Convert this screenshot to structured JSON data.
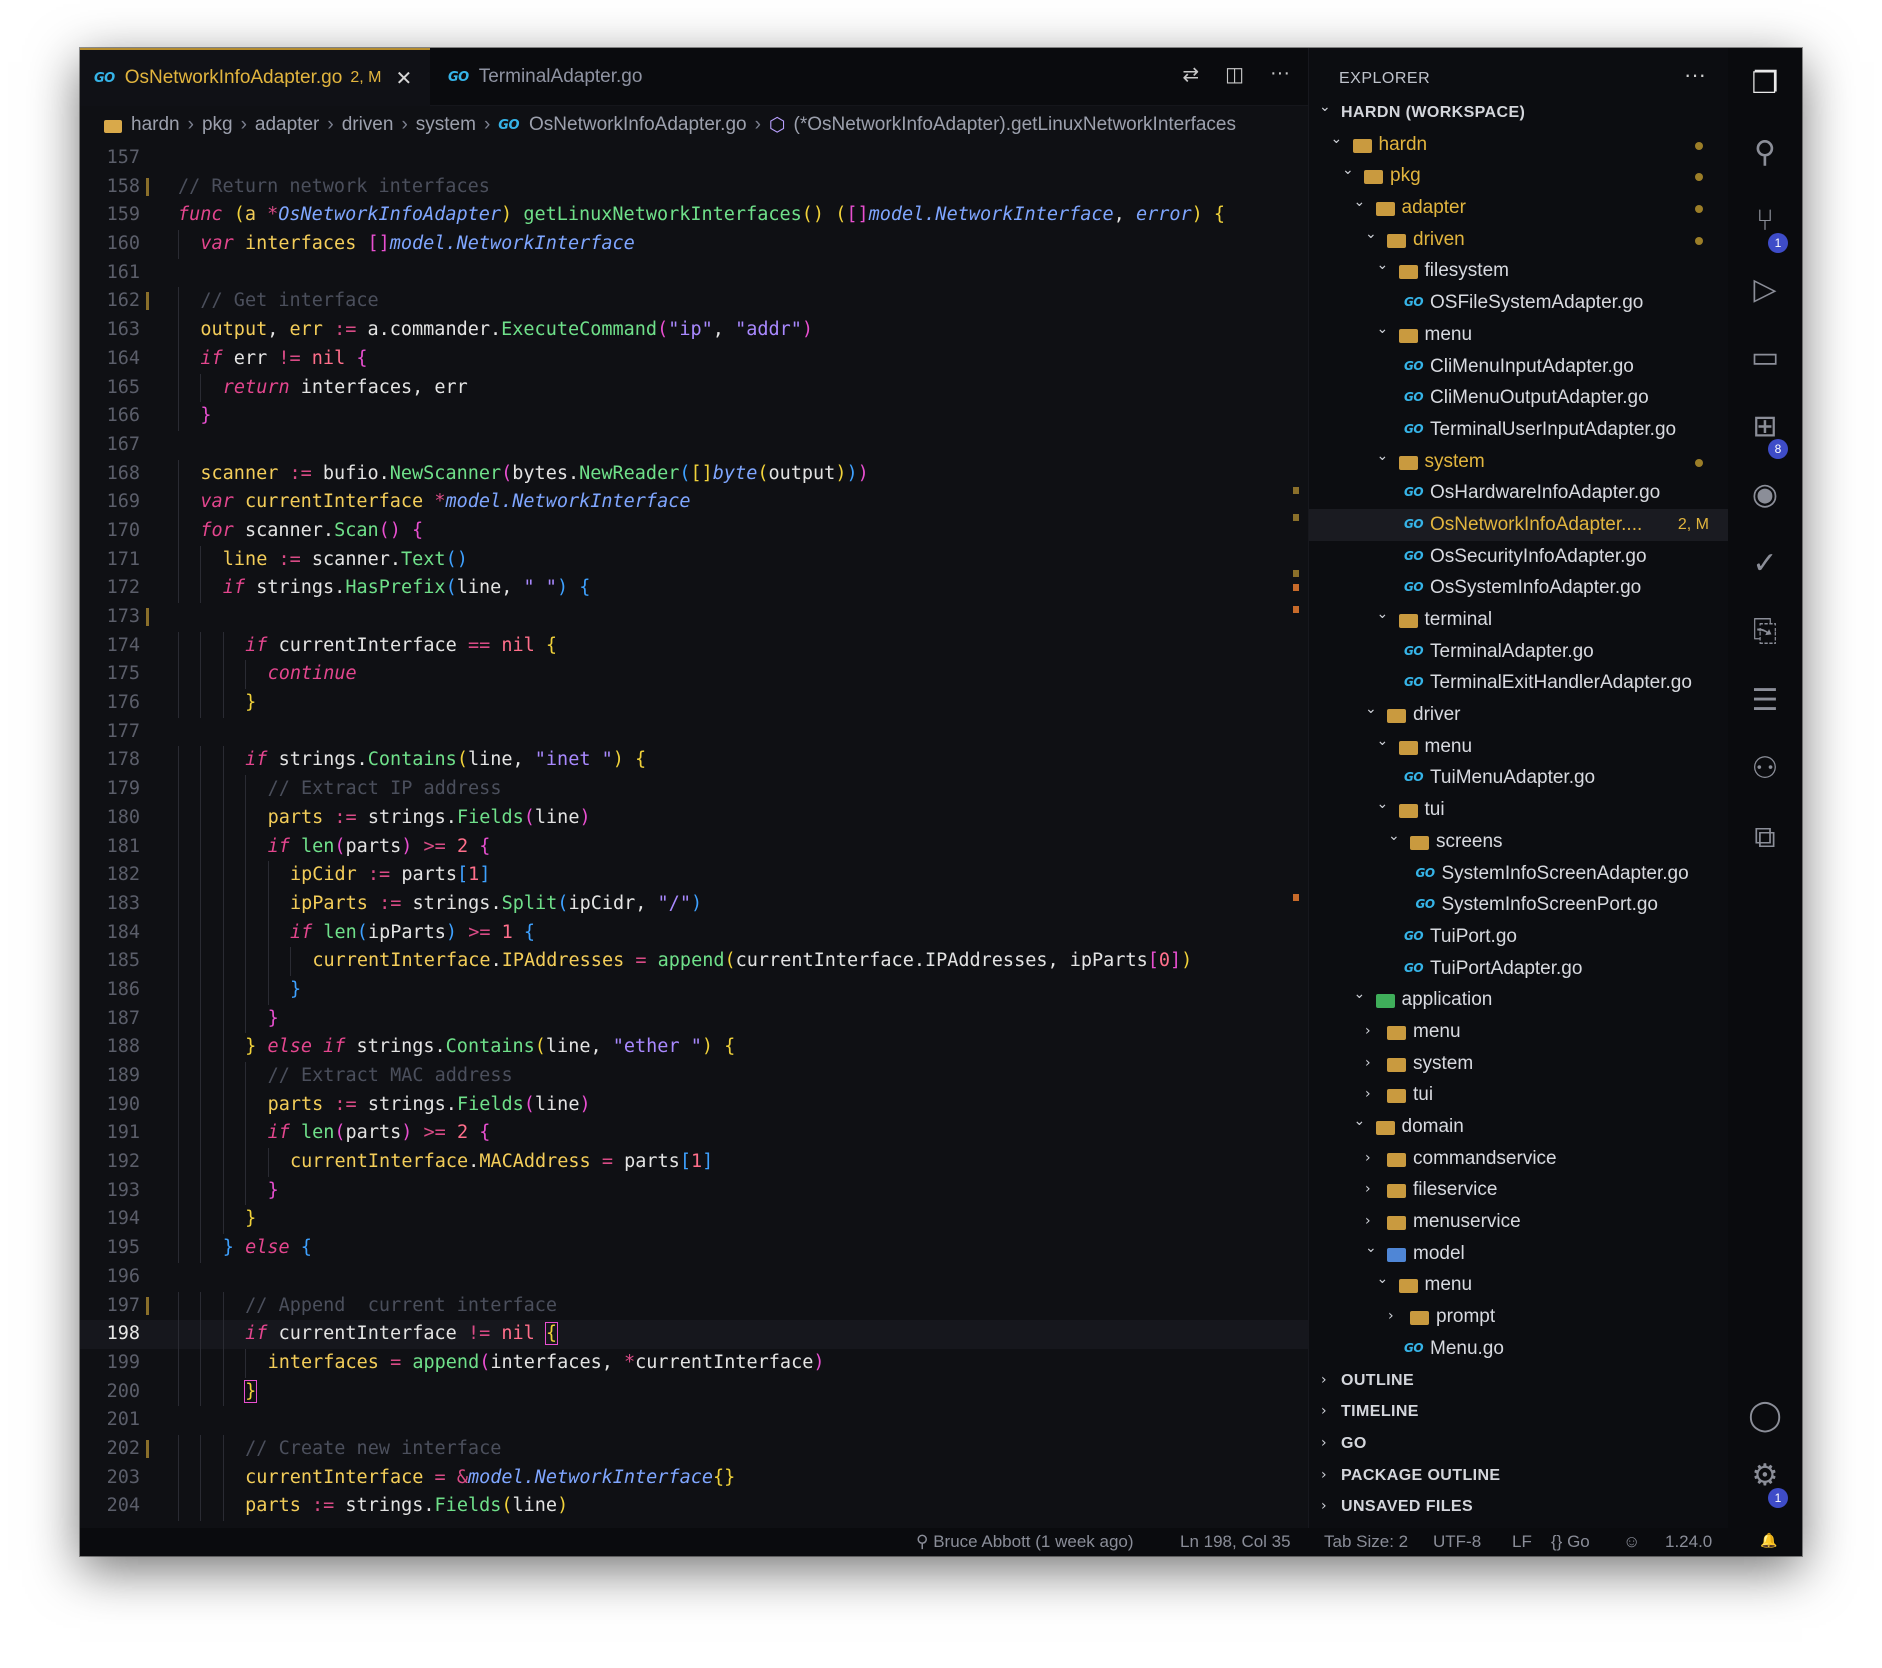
{
  "tabs": [
    {
      "label": "OsNetworkInfoAdapter.go",
      "status": "2, M",
      "close": "✕",
      "lang": "GO"
    },
    {
      "label": "TerminalAdapter.go",
      "lang": "GO"
    }
  ],
  "tab_actions": [
    "git-compare-icon",
    "split-editor-icon",
    "more-actions-icon"
  ],
  "breadcrumbs": [
    "hardn",
    "pkg",
    "adapter",
    "driven",
    "system",
    "OsNetworkInfoAdapter.go",
    "(*OsNetworkInfoAdapter).getLinuxNetworkInterfaces"
  ],
  "editor": {
    "current_line": "198",
    "lines": [
      {
        "n": "157",
        "html": ""
      },
      {
        "n": "158",
        "html": "<span class=\"cm\">// Return network interfaces</span>"
      },
      {
        "n": "159",
        "html": "<span class=\"kw\">func</span> <span class=\"b1\">(</span><span class=\"va\">a</span> <span class=\"op\">*</span><span class=\"ty\">OsNetworkInfoAdapter</span><span class=\"b1\">)</span> <span class=\"fn\">getLinuxNetworkInterfaces</span><span class=\"b1\">()</span> <span class=\"b1\">(</span><span class=\"b2\">[]</span><span class=\"ty\">model.NetworkInterface</span>, <span class=\"ty\">error</span><span class=\"b1\">)</span> <span class=\"b1\">{</span>"
      },
      {
        "n": "160",
        "html": "<span class=\"ig\"></span><span class=\"kw\">var</span> <span class=\"va\">interfaces</span> <span class=\"b2\">[]</span><span class=\"ty\">model.NetworkInterface</span>"
      },
      {
        "n": "161",
        "html": ""
      },
      {
        "n": "162",
        "html": "<span class=\"ig\"></span><span class=\"cm\">// Get interface</span>"
      },
      {
        "n": "163",
        "html": "<span class=\"ig\"></span><span class=\"va\">output</span>, <span class=\"va\">err</span> <span class=\"op\">:=</span> a.commander.<span class=\"fn\">ExecuteCommand</span><span class=\"b2\">(</span><span class=\"st\">\"ip\"</span>, <span class=\"st\">\"addr\"</span><span class=\"b2\">)</span>"
      },
      {
        "n": "164",
        "html": "<span class=\"ig\"></span><span class=\"kw\">if</span> err <span class=\"op\">!=</span> <span class=\"nu\">nil</span> <span class=\"b2\">{</span>"
      },
      {
        "n": "165",
        "html": "<span class=\"ig\"></span><span class=\"ig\"></span><span class=\"kw\">return</span> interfaces, err"
      },
      {
        "n": "166",
        "html": "<span class=\"ig\"></span><span class=\"b2\">}</span>"
      },
      {
        "n": "167",
        "html": ""
      },
      {
        "n": "168",
        "html": "<span class=\"ig\"></span><span class=\"va\">scanner</span> <span class=\"op\">:=</span> bufio.<span class=\"fn\">NewScanner</span><span class=\"b2\">(</span>bytes.<span class=\"fn\">NewReader</span><span class=\"b3\">(</span><span class=\"b1\">[]</span><span class=\"ty\">byte</span><span class=\"b1\">(</span>output<span class=\"b1\">)</span><span class=\"b3\">)</span><span class=\"b2\">)</span>"
      },
      {
        "n": "169",
        "html": "<span class=\"ig\"></span><span class=\"kw\">var</span> <span class=\"va\">currentInterface</span> <span class=\"op\">*</span><span class=\"ty\">model.NetworkInterface</span>"
      },
      {
        "n": "170",
        "html": "<span class=\"ig\"></span><span class=\"kw\">for</span> scanner.<span class=\"fn\">Scan</span><span class=\"b2\">()</span> <span class=\"b2\">{</span>"
      },
      {
        "n": "171",
        "html": "<span class=\"ig\"></span><span class=\"ig\"></span><span class=\"va\">line</span> <span class=\"op\">:=</span> scanner.<span class=\"fn\">Text</span><span class=\"b3\">()</span>"
      },
      {
        "n": "172",
        "html": "<span class=\"ig\"></span><span class=\"ig\"></span><span class=\"kw\">if</span> strings.<span class=\"fn\">HasPrefix</span><span class=\"b3\">(</span>line, <span class=\"st\">\" \"</span><span class=\"b3\">)</span> <span class=\"b3\">{</span>"
      },
      {
        "n": "173",
        "html": ""
      },
      {
        "n": "174",
        "html": "<span class=\"ig\"></span><span class=\"ig\"></span><span class=\"ig\"></span><span class=\"kw\">if</span> currentInterface <span class=\"op\">==</span> <span class=\"nu\">nil</span> <span class=\"b1\">{</span>"
      },
      {
        "n": "175",
        "html": "<span class=\"ig\"></span><span class=\"ig\"></span><span class=\"ig\"></span><span class=\"ig\"></span><span class=\"kw\">continue</span>"
      },
      {
        "n": "176",
        "html": "<span class=\"ig\"></span><span class=\"ig\"></span><span class=\"ig\"></span><span class=\"b1\">}</span>"
      },
      {
        "n": "177",
        "html": ""
      },
      {
        "n": "178",
        "html": "<span class=\"ig\"></span><span class=\"ig\"></span><span class=\"ig\"></span><span class=\"kw\">if</span> strings.<span class=\"fn\">Contains</span><span class=\"b1\">(</span>line, <span class=\"st\">\"inet \"</span><span class=\"b1\">)</span> <span class=\"b1\">{</span>"
      },
      {
        "n": "179",
        "html": "<span class=\"ig\"></span><span class=\"ig\"></span><span class=\"ig\"></span><span class=\"ig\"></span><span class=\"cm\">// Extract IP address</span>"
      },
      {
        "n": "180",
        "html": "<span class=\"ig\"></span><span class=\"ig\"></span><span class=\"ig\"></span><span class=\"ig\"></span><span class=\"va\">parts</span> <span class=\"op\">:=</span> strings.<span class=\"fn\">Fields</span><span class=\"b2\">(</span>line<span class=\"b2\">)</span>"
      },
      {
        "n": "181",
        "html": "<span class=\"ig\"></span><span class=\"ig\"></span><span class=\"ig\"></span><span class=\"ig\"></span><span class=\"kw\">if</span> <span class=\"fn\">len</span><span class=\"b2\">(</span>parts<span class=\"b2\">)</span> <span class=\"op\">>=</span> <span class=\"nu\">2</span> <span class=\"b2\">{</span>"
      },
      {
        "n": "182",
        "html": "<span class=\"ig\"></span><span class=\"ig\"></span><span class=\"ig\"></span><span class=\"ig\"></span><span class=\"ig\"></span><span class=\"va\">ipCidr</span> <span class=\"op\">:=</span> parts<span class=\"b3\">[</span><span class=\"nu\">1</span><span class=\"b3\">]</span>"
      },
      {
        "n": "183",
        "html": "<span class=\"ig\"></span><span class=\"ig\"></span><span class=\"ig\"></span><span class=\"ig\"></span><span class=\"ig\"></span><span class=\"va\">ipParts</span> <span class=\"op\">:=</span> strings.<span class=\"fn\">Split</span><span class=\"b3\">(</span>ipCidr, <span class=\"st\">\"/\"</span><span class=\"b3\">)</span>"
      },
      {
        "n": "184",
        "html": "<span class=\"ig\"></span><span class=\"ig\"></span><span class=\"ig\"></span><span class=\"ig\"></span><span class=\"ig\"></span><span class=\"kw\">if</span> <span class=\"fn\">len</span><span class=\"b3\">(</span>ipParts<span class=\"b3\">)</span> <span class=\"op\">>=</span> <span class=\"nu\">1</span> <span class=\"b3\">{</span>"
      },
      {
        "n": "185",
        "html": "<span class=\"ig\"></span><span class=\"ig\"></span><span class=\"ig\"></span><span class=\"ig\"></span><span class=\"ig\"></span><span class=\"ig\"></span><span class=\"va\">currentInterface</span>.<span class=\"va\">IPAddresses</span> <span class=\"op\">=</span> <span class=\"fn\">append</span><span class=\"b1\">(</span>currentInterface.IPAddresses, ipParts<span class=\"b2\">[</span><span class=\"nu\">0</span><span class=\"b2\">]</span><span class=\"b1\">)</span>"
      },
      {
        "n": "186",
        "html": "<span class=\"ig\"></span><span class=\"ig\"></span><span class=\"ig\"></span><span class=\"ig\"></span><span class=\"ig\"></span><span class=\"b3\">}</span>"
      },
      {
        "n": "187",
        "html": "<span class=\"ig\"></span><span class=\"ig\"></span><span class=\"ig\"></span><span class=\"ig\"></span><span class=\"b2\">}</span>"
      },
      {
        "n": "188",
        "html": "<span class=\"ig\"></span><span class=\"ig\"></span><span class=\"ig\"></span><span class=\"b1\">}</span> <span class=\"kw\">else if</span> strings.<span class=\"fn\">Contains</span><span class=\"b1\">(</span>line, <span class=\"st\">\"ether \"</span><span class=\"b1\">)</span> <span class=\"b1\">{</span>"
      },
      {
        "n": "189",
        "html": "<span class=\"ig\"></span><span class=\"ig\"></span><span class=\"ig\"></span><span class=\"ig\"></span><span class=\"cm\">// Extract MAC address</span>"
      },
      {
        "n": "190",
        "html": "<span class=\"ig\"></span><span class=\"ig\"></span><span class=\"ig\"></span><span class=\"ig\"></span><span class=\"va\">parts</span> <span class=\"op\">:=</span> strings.<span class=\"fn\">Fields</span><span class=\"b2\">(</span>line<span class=\"b2\">)</span>"
      },
      {
        "n": "191",
        "html": "<span class=\"ig\"></span><span class=\"ig\"></span><span class=\"ig\"></span><span class=\"ig\"></span><span class=\"kw\">if</span> <span class=\"fn\">len</span><span class=\"b2\">(</span>parts<span class=\"b2\">)</span> <span class=\"op\">>=</span> <span class=\"nu\">2</span> <span class=\"b2\">{</span>"
      },
      {
        "n": "192",
        "html": "<span class=\"ig\"></span><span class=\"ig\"></span><span class=\"ig\"></span><span class=\"ig\"></span><span class=\"ig\"></span><span class=\"va\">currentInterface</span>.<span class=\"va\">MACAddress</span> <span class=\"op\">=</span> parts<span class=\"b3\">[</span><span class=\"nu\">1</span><span class=\"b3\">]</span>"
      },
      {
        "n": "193",
        "html": "<span class=\"ig\"></span><span class=\"ig\"></span><span class=\"ig\"></span><span class=\"ig\"></span><span class=\"b2\">}</span>"
      },
      {
        "n": "194",
        "html": "<span class=\"ig\"></span><span class=\"ig\"></span><span class=\"ig\"></span><span class=\"b1\">}</span>"
      },
      {
        "n": "195",
        "html": "<span class=\"ig\"></span><span class=\"ig\"></span><span class=\"b3\">}</span> <span class=\"kw\">else</span> <span class=\"b3\">{</span>"
      },
      {
        "n": "196",
        "html": ""
      },
      {
        "n": "197",
        "html": "<span class=\"ig\"></span><span class=\"ig\"></span><span class=\"ig\"></span><span class=\"cm\">// Append  current interface</span>"
      },
      {
        "n": "198",
        "html": "<span class=\"ig\"></span><span class=\"ig\"></span><span class=\"ig\"></span><span class=\"kw\">if</span> currentInterface <span class=\"op\">!=</span> <span class=\"nu\">nil</span> <span class=\"b1\" style=\"outline:1px solid #e84fd0\">{</span>"
      },
      {
        "n": "199",
        "html": "<span class=\"ig\"></span><span class=\"ig\"></span><span class=\"ig\"></span><span class=\"ig\"></span><span class=\"va\">interfaces</span> <span class=\"op\">=</span> <span class=\"fn\">append</span><span class=\"b2\">(</span>interfaces, <span class=\"op\">*</span>currentInterface<span class=\"b2\">)</span>"
      },
      {
        "n": "200",
        "html": "<span class=\"ig\"></span><span class=\"ig\"></span><span class=\"ig\"></span><span class=\"b1\" style=\"outline:1px solid #e84fd0\">}</span>"
      },
      {
        "n": "201",
        "html": ""
      },
      {
        "n": "202",
        "html": "<span class=\"ig\"></span><span class=\"ig\"></span><span class=\"ig\"></span><span class=\"cm\">// Create new interface</span>"
      },
      {
        "n": "203",
        "html": "<span class=\"ig\"></span><span class=\"ig\"></span><span class=\"ig\"></span><span class=\"va\">currentInterface</span> <span class=\"op\">=</span> <span class=\"op\">&amp;</span><span class=\"ty\">model.NetworkInterface</span><span class=\"b1\">{}</span>"
      },
      {
        "n": "204",
        "html": "<span class=\"ig\"></span><span class=\"ig\"></span><span class=\"ig\"></span><span class=\"va\">parts</span> <span class=\"op\">:=</span> strings.<span class=\"fn\">Fields</span><span class=\"b1\">(</span>line<span class=\"b1\">)</span>"
      }
    ],
    "modified_gutter_lines": [
      "158",
      "162",
      "173",
      "197",
      "202"
    ]
  },
  "explorer": {
    "title": "EXPLORER",
    "more": "···",
    "tree": [
      {
        "label": "HARDN (WORKSPACE)",
        "depth": 0,
        "kind": "section",
        "open": true
      },
      {
        "label": "hardn",
        "depth": 1,
        "kind": "folder",
        "open": true,
        "dot": true
      },
      {
        "label": "pkg",
        "depth": 2,
        "kind": "folder",
        "open": true,
        "dot": true
      },
      {
        "label": "adapter",
        "depth": 3,
        "kind": "folder",
        "open": true,
        "dot": true
      },
      {
        "label": "driven",
        "depth": 4,
        "kind": "folder",
        "open": true,
        "dot": true
      },
      {
        "label": "filesystem",
        "depth": 5,
        "kind": "folder",
        "open": true
      },
      {
        "label": "OSFileSystemAdapter.go",
        "depth": 6,
        "kind": "go"
      },
      {
        "label": "menu",
        "depth": 5,
        "kind": "folder",
        "open": true
      },
      {
        "label": "CliMenuInputAdapter.go",
        "depth": 6,
        "kind": "go"
      },
      {
        "label": "CliMenuOutputAdapter.go",
        "depth": 6,
        "kind": "go"
      },
      {
        "label": "TerminalUserInputAdapter.go",
        "depth": 6,
        "kind": "go"
      },
      {
        "label": "system",
        "depth": 5,
        "kind": "folder",
        "open": true,
        "dot": true
      },
      {
        "label": "OsHardwareInfoAdapter.go",
        "depth": 6,
        "kind": "go"
      },
      {
        "label": "OsNetworkInfoAdapter....",
        "depth": 6,
        "kind": "go",
        "selected": true,
        "status": "2, M"
      },
      {
        "label": "OsSecurityInfoAdapter.go",
        "depth": 6,
        "kind": "go"
      },
      {
        "label": "OsSystemInfoAdapter.go",
        "depth": 6,
        "kind": "go"
      },
      {
        "label": "terminal",
        "depth": 5,
        "kind": "folder",
        "open": true
      },
      {
        "label": "TerminalAdapter.go",
        "depth": 6,
        "kind": "go"
      },
      {
        "label": "TerminalExitHandlerAdapter.go",
        "depth": 6,
        "kind": "go"
      },
      {
        "label": "driver",
        "depth": 4,
        "kind": "folder",
        "open": true
      },
      {
        "label": "menu",
        "depth": 5,
        "kind": "folder",
        "open": true
      },
      {
        "label": "TuiMenuAdapter.go",
        "depth": 6,
        "kind": "go"
      },
      {
        "label": "tui",
        "depth": 5,
        "kind": "folder",
        "open": true
      },
      {
        "label": "screens",
        "depth": 6,
        "kind": "folder",
        "open": true
      },
      {
        "label": "SystemInfoScreenAdapter.go",
        "depth": 7,
        "kind": "go"
      },
      {
        "label": "SystemInfoScreenPort.go",
        "depth": 7,
        "kind": "go"
      },
      {
        "label": "TuiPort.go",
        "depth": 6,
        "kind": "go"
      },
      {
        "label": "TuiPortAdapter.go",
        "depth": 6,
        "kind": "go"
      },
      {
        "label": "application",
        "depth": 3,
        "kind": "folder",
        "open": true,
        "color": "#3fae5a"
      },
      {
        "label": "menu",
        "depth": 4,
        "kind": "folder",
        "open": false
      },
      {
        "label": "system",
        "depth": 4,
        "kind": "folder",
        "open": false
      },
      {
        "label": "tui",
        "depth": 4,
        "kind": "folder",
        "open": false
      },
      {
        "label": "domain",
        "depth": 3,
        "kind": "folder",
        "open": true
      },
      {
        "label": "commandservice",
        "depth": 4,
        "kind": "folder",
        "open": false
      },
      {
        "label": "fileservice",
        "depth": 4,
        "kind": "folder",
        "open": false
      },
      {
        "label": "menuservice",
        "depth": 4,
        "kind": "folder",
        "open": false
      },
      {
        "label": "model",
        "depth": 4,
        "kind": "folder",
        "open": true,
        "color": "#4f86d6"
      },
      {
        "label": "menu",
        "depth": 5,
        "kind": "folder",
        "open": true
      },
      {
        "label": "prompt",
        "depth": 6,
        "kind": "folder",
        "open": false
      },
      {
        "label": "Menu.go",
        "depth": 6,
        "kind": "go"
      }
    ],
    "sections": [
      "OUTLINE",
      "TIMELINE",
      "GO",
      "PACKAGE OUTLINE",
      "UNSAVED FILES"
    ]
  },
  "activity_bar": [
    {
      "icon": "explorer-icon",
      "glyph": "❐",
      "active": true
    },
    {
      "icon": "search-icon",
      "glyph": "⚲"
    },
    {
      "icon": "source-control-icon",
      "glyph": "⑂",
      "badge": "1"
    },
    {
      "icon": "run-debug-icon",
      "glyph": "▷"
    },
    {
      "icon": "remote-explorer-icon",
      "glyph": "▭"
    },
    {
      "icon": "extensions-icon",
      "glyph": "⊞",
      "badge": "8"
    },
    {
      "icon": "spotify-icon",
      "glyph": "◉"
    },
    {
      "icon": "testing-icon",
      "glyph": "✓"
    },
    {
      "icon": "timeline-icon",
      "glyph": "⎘"
    },
    {
      "icon": "outline-icon",
      "glyph": "☰"
    },
    {
      "icon": "copilot-icon",
      "glyph": "⚇"
    },
    {
      "icon": "diagram-icon",
      "glyph": "⧉"
    }
  ],
  "activity_bottom": [
    {
      "icon": "account-icon",
      "glyph": "◯"
    },
    {
      "icon": "manage-gear-icon",
      "glyph": "⚙",
      "badge": "1"
    }
  ],
  "status_bar": {
    "blame": "Bruce Abbott (1 week ago)",
    "position": "Ln 198, Col 35",
    "tab_size": "Tab Size: 2",
    "encoding": "UTF-8",
    "eol": "LF",
    "language": "{} Go",
    "copilot": "☺",
    "go_version": "1.24.0",
    "bell": "🔔"
  }
}
